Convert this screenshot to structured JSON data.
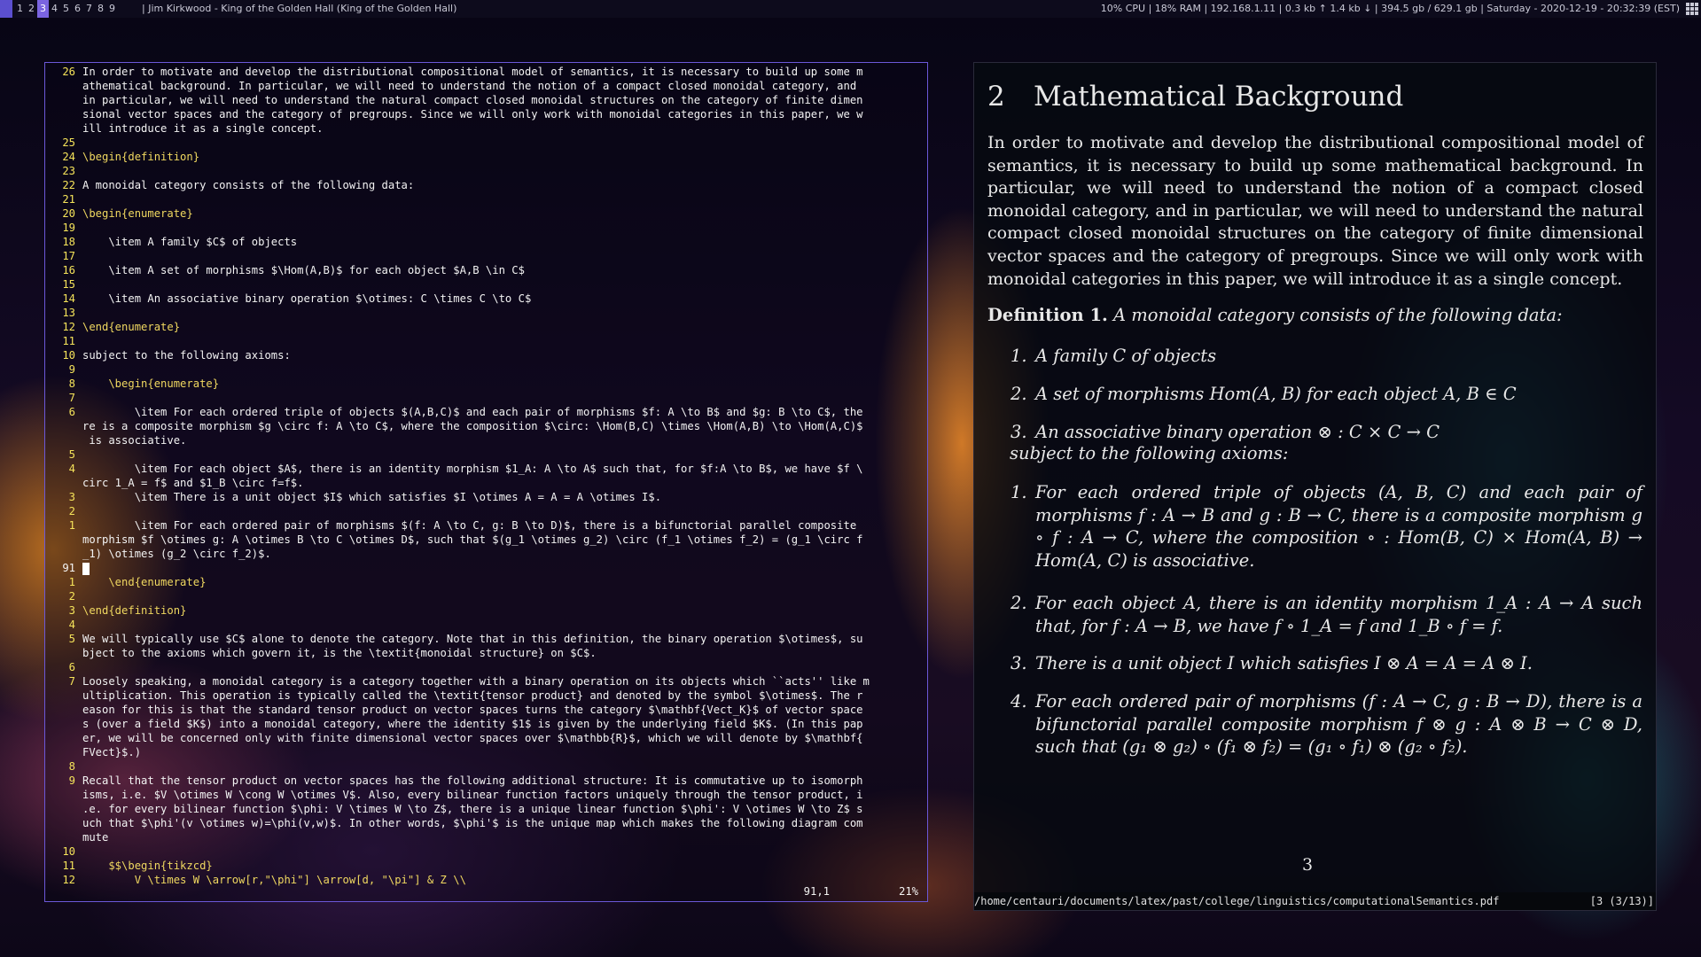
{
  "topbar": {
    "workspaces": [
      "1",
      "2",
      "3",
      "4",
      "5",
      "6",
      "7",
      "8",
      "9"
    ],
    "active_workspace": "3",
    "window_title": "|  Jim Kirkwood - King of the Golden Hall (King of the Golden Hall)",
    "status": "10% CPU  |  18% RAM  |  192.168.1.11  |  0.3 kb ↑  1.4 kb ↓  |  394.5 gb / 629.1 gb  |  Saturday - 2020-12-19 - 20:32:39 (EST)"
  },
  "editor": {
    "lines": [
      {
        "n": "26",
        "t": "In order to motivate and develop the distributional compositional model of semantics, it is necessary to build up some m",
        "s": ""
      },
      {
        "n": "",
        "t": "athematical background. In particular, we will need to understand the notion of a compact closed monoidal category, and",
        "s": ""
      },
      {
        "n": "",
        "t": "in particular, we will need to understand the natural compact closed monoidal structures on the category of finite dimen",
        "s": ""
      },
      {
        "n": "",
        "t": "sional vector spaces and the category of pregroups. Since we will only work with monoidal categories in this paper, we w",
        "s": ""
      },
      {
        "n": "",
        "t": "ill introduce it as a single concept.",
        "s": ""
      },
      {
        "n": "25",
        "t": "",
        "s": ""
      },
      {
        "n": "24",
        "t": "\\begin{definition}",
        "s": "kw"
      },
      {
        "n": "23",
        "t": "",
        "s": ""
      },
      {
        "n": "22",
        "t": "A monoidal category consists of the following data:",
        "s": ""
      },
      {
        "n": "21",
        "t": "",
        "s": ""
      },
      {
        "n": "20",
        "t": "\\begin{enumerate}",
        "s": "kw"
      },
      {
        "n": "19",
        "t": "",
        "s": ""
      },
      {
        "n": "18",
        "t": "    \\item A family $C$ of objects",
        "s": ""
      },
      {
        "n": "17",
        "t": "",
        "s": ""
      },
      {
        "n": "16",
        "t": "    \\item A set of morphisms $\\Hom(A,B)$ for each object $A,B \\in C$",
        "s": ""
      },
      {
        "n": "15",
        "t": "",
        "s": ""
      },
      {
        "n": "14",
        "t": "    \\item An associative binary operation $\\otimes: C \\times C \\to C$",
        "s": ""
      },
      {
        "n": "13",
        "t": "",
        "s": ""
      },
      {
        "n": "12",
        "t": "\\end{enumerate}",
        "s": "kw"
      },
      {
        "n": "11",
        "t": "",
        "s": ""
      },
      {
        "n": "10",
        "t": "subject to the following axioms:",
        "s": ""
      },
      {
        "n": "9",
        "t": "",
        "s": ""
      },
      {
        "n": "8",
        "t": "    \\begin{enumerate}",
        "s": "kw"
      },
      {
        "n": "7",
        "t": "",
        "s": ""
      },
      {
        "n": "6",
        "t": "        \\item For each ordered triple of objects $(A,B,C)$ and each pair of morphisms $f: A \\to B$ and $g: B \\to C$, the",
        "s": ""
      },
      {
        "n": "",
        "t": "re is a composite morphism $g \\circ f: A \\to C$, where the composition $\\circ: \\Hom(B,C) \\times \\Hom(A,B) \\to \\Hom(A,C)$",
        "s": ""
      },
      {
        "n": "",
        "t": " is associative.",
        "s": ""
      },
      {
        "n": "5",
        "t": "",
        "s": ""
      },
      {
        "n": "4",
        "t": "        \\item For each object $A$, there is an identity morphism $1_A: A \\to A$ such that, for $f:A \\to B$, we have $f \\",
        "s": ""
      },
      {
        "n": "",
        "t": "circ 1_A = f$ and $1_B \\circ f=f$.",
        "s": ""
      },
      {
        "n": "3",
        "t": "        \\item There is a unit object $I$ which satisfies $I \\otimes A = A = A \\otimes I$.",
        "s": ""
      },
      {
        "n": "2",
        "t": "",
        "s": ""
      },
      {
        "n": "1",
        "t": "        \\item For each ordered pair of morphisms $(f: A \\to C, g: B \\to D)$, there is a bifunctorial parallel composite",
        "s": ""
      },
      {
        "n": "",
        "t": "morphism $f \\otimes g: A \\otimes B \\to C \\otimes D$, such that $(g_1 \\otimes g_2) \\circ (f_1 \\otimes f_2) = (g_1 \\circ f",
        "s": ""
      },
      {
        "n": "",
        "t": "_1) \\otimes (g_2 \\circ f_2)$.",
        "s": ""
      },
      {
        "n": "91",
        "t": "",
        "s": "cursor"
      },
      {
        "n": "1",
        "t": "    \\end{enumerate}",
        "s": "kw"
      },
      {
        "n": "2",
        "t": "",
        "s": ""
      },
      {
        "n": "3",
        "t": "\\end{definition}",
        "s": "kw"
      },
      {
        "n": "4",
        "t": "",
        "s": ""
      },
      {
        "n": "5",
        "t": "We will typically use $C$ alone to denote the category. Note that in this definition, the binary operation $\\otimes$, su",
        "s": ""
      },
      {
        "n": "",
        "t": "bject to the axioms which govern it, is the \\textit{monoidal structure} on $C$.",
        "s": ""
      },
      {
        "n": "6",
        "t": "",
        "s": ""
      },
      {
        "n": "7",
        "t": "Loosely speaking, a monoidal category is a category together with a binary operation on its objects which ``acts'' like m",
        "s": ""
      },
      {
        "n": "",
        "t": "ultiplication. This operation is typically called the \\textit{tensor product} and denoted by the symbol $\\otimes$. The r",
        "s": ""
      },
      {
        "n": "",
        "t": "eason for this is that the standard tensor product on vector spaces turns the category $\\mathbf{Vect_K}$ of vector space",
        "s": ""
      },
      {
        "n": "",
        "t": "s (over a field $K$) into a monoidal category, where the identity $1$ is given by the underlying field $K$. (In this pap",
        "s": ""
      },
      {
        "n": "",
        "t": "er, we will be concerned only with finite dimensional vector spaces over $\\mathbb{R}$, which we will denote by $\\mathbf{",
        "s": ""
      },
      {
        "n": "",
        "t": "FVect}$.)",
        "s": ""
      },
      {
        "n": "8",
        "t": "",
        "s": ""
      },
      {
        "n": "9",
        "t": "Recall that the tensor product on vector spaces has the following additional structure: It is commutative up to isomorph",
        "s": ""
      },
      {
        "n": "",
        "t": "isms, i.e. $V \\otimes W \\cong W \\otimes V$. Also, every bilinear function factors uniquely through the tensor product, i",
        "s": ""
      },
      {
        "n": "",
        "t": ".e. for every bilinear function $\\phi: V \\times W \\to Z$, there is a unique linear function $\\phi': V \\otimes W \\to Z$ s",
        "s": ""
      },
      {
        "n": "",
        "t": "uch that $\\phi'(v \\otimes w)=\\phi(v,w)$. In other words, $\\phi'$ is the unique map which makes the following diagram com",
        "s": ""
      },
      {
        "n": "",
        "t": "mute",
        "s": ""
      },
      {
        "n": "10",
        "t": "",
        "s": ""
      },
      {
        "n": "11",
        "t": "    $$\\begin{tikzcd}",
        "s": "kw"
      },
      {
        "n": "12",
        "t": "        V \\times W \\arrow[r,\"\\phi\"] \\arrow[d, \"\\pi\"] & Z \\\\",
        "s": "kw"
      }
    ],
    "cursor_position": "91,1",
    "scroll_percent": "21%"
  },
  "pdf": {
    "section_number": "2",
    "section_title": "Mathematical Background",
    "intro": "In order to motivate and develop the distributional compositional model of semantics, it is necessary to build up some mathematical background. In particular, we will need to understand the notion of a compact closed monoidal category, and in particular, we will need to understand the natural compact closed monoidal structures on the category of finite dimensional vector spaces and the category of pregroups. Since we will only work with monoidal categories in this paper, we will introduce it as a single concept.",
    "definition_label": "Definition 1.",
    "definition_text": "A monoidal category consists of the following data:",
    "data_items": [
      {
        "k": "1.",
        "v": "A family C of objects"
      },
      {
        "k": "2.",
        "v": "A set of morphisms Hom(A, B) for each object A, B ∈ C"
      },
      {
        "k": "3.",
        "v": "An associative binary operation ⊗ : C × C → C"
      }
    ],
    "axioms_intro": "subject to the following axioms:",
    "axioms": [
      {
        "k": "1.",
        "v": "For each ordered triple of objects (A, B, C) and each pair of morphisms f : A → B and g : B → C, there is a composite morphism g ∘ f : A → C, where the composition ∘ : Hom(B, C) × Hom(A, B) → Hom(A, C) is associative."
      },
      {
        "k": "2.",
        "v": "For each object A, there is an identity morphism 1_A : A → A such that, for f : A → B, we have f ∘ 1_A = f and 1_B ∘ f = f."
      },
      {
        "k": "3.",
        "v": "There is a unit object I which satisfies I ⊗ A = A = A ⊗ I."
      },
      {
        "k": "4.",
        "v": "For each ordered pair of morphisms (f : A → C, g : B → D), there is a bifunctorial parallel composite morphism f ⊗ g : A ⊗ B → C ⊗ D, such that (g₁ ⊗ g₂) ∘ (f₁ ⊗ f₂) = (g₁ ∘ f₁) ⊗ (g₂ ∘ f₂)."
      }
    ],
    "page_number": "3",
    "file_path": "/home/centauri/documents/latex/past/college/linguistics/computationalSemantics.pdf",
    "page_indicator": "[3 (3/13)]"
  }
}
